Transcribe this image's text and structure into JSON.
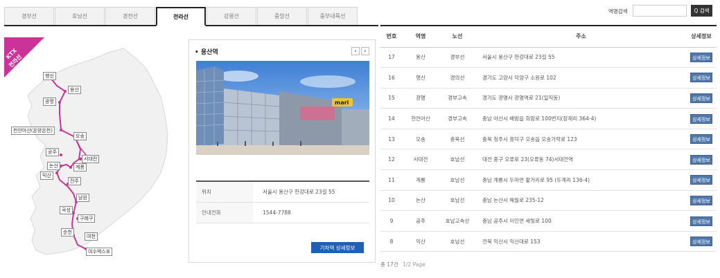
{
  "tabs": [
    {
      "label": "경부선",
      "active": false
    },
    {
      "label": "호남선",
      "active": false
    },
    {
      "label": "경전선",
      "active": false
    },
    {
      "label": "전라선",
      "active": true
    },
    {
      "label": "강릉선",
      "active": false
    },
    {
      "label": "중앙선",
      "active": false
    },
    {
      "label": "중부내륙선",
      "active": false
    }
  ],
  "map": {
    "ribbon_line1": "KTX",
    "ribbon_line2": "전라선",
    "line_color": "#cc3399",
    "ribbon_color": "#cc3399",
    "stations": [
      "행신",
      "용산",
      "광명",
      "천안아산(온양온천)",
      "오송",
      "공주",
      "서대전",
      "논산",
      "계룡",
      "익산",
      "전주",
      "남원",
      "곡성",
      "구례구",
      "순천",
      "여천",
      "여수엑스포"
    ]
  },
  "card": {
    "title": "용산역",
    "prev_icon": "‹",
    "next_icon": "›",
    "photo_sign": "mari",
    "rows": [
      {
        "key": "위치",
        "value": "서울시 용산구 한강대로 23길 55"
      },
      {
        "key": "안내전화",
        "value": "1544-7788"
      }
    ],
    "detail_button": "기차역 상세정보"
  },
  "search": {
    "label": "역명검색",
    "value": "",
    "placeholder": "",
    "button": "Q 검색"
  },
  "table": {
    "headers": [
      "번호",
      "역명",
      "노선",
      "주소",
      "상세정보"
    ],
    "rows": [
      {
        "no": "17",
        "name": "용산",
        "line": "경부선",
        "addr": "서울시 용산구 한강대로 23길 55",
        "btn": "상세정보"
      },
      {
        "no": "16",
        "name": "행신",
        "line": "경의선",
        "addr": "경기도 고양시 덕양구 소원로 102",
        "btn": "상세정보"
      },
      {
        "no": "15",
        "name": "광명",
        "line": "경부고속",
        "addr": "경기도 광명시 광명역로 21(일직동)",
        "btn": "상세정보"
      },
      {
        "no": "14",
        "name": "천안아산",
        "line": "경부고속",
        "addr": "충남 아산시 배방읍 희망로 100번지(장재리 364-4)",
        "btn": "상세정보"
      },
      {
        "no": "13",
        "name": "오송",
        "line": "충북선",
        "addr": "충북 청주시 흥덕구 오송읍 오송가락로 123",
        "btn": "상세정보"
      },
      {
        "no": "12",
        "name": "서대전",
        "line": "호남선",
        "addr": "대전 중구 오류로 23(오류동 74)서대전역",
        "btn": "상세정보"
      },
      {
        "no": "11",
        "name": "계룡",
        "line": "호남선",
        "addr": "충남 계룡시 두마면 팥거리로 95 (두계리 136-4)",
        "btn": "상세정보"
      },
      {
        "no": "10",
        "name": "논산",
        "line": "호남선",
        "addr": "충남 논산시 해월로 235-12",
        "btn": "상세정보"
      },
      {
        "no": "9",
        "name": "공주",
        "line": "호남고속선",
        "addr": "충남 공주시 이인면 새빛로 100",
        "btn": "상세정보"
      },
      {
        "no": "8",
        "name": "익산",
        "line": "호남선",
        "addr": "전북 익산시 익산대로 153",
        "btn": "상세정보"
      }
    ]
  },
  "paging": {
    "total": "총 17건",
    "page": "1/2 Page"
  }
}
